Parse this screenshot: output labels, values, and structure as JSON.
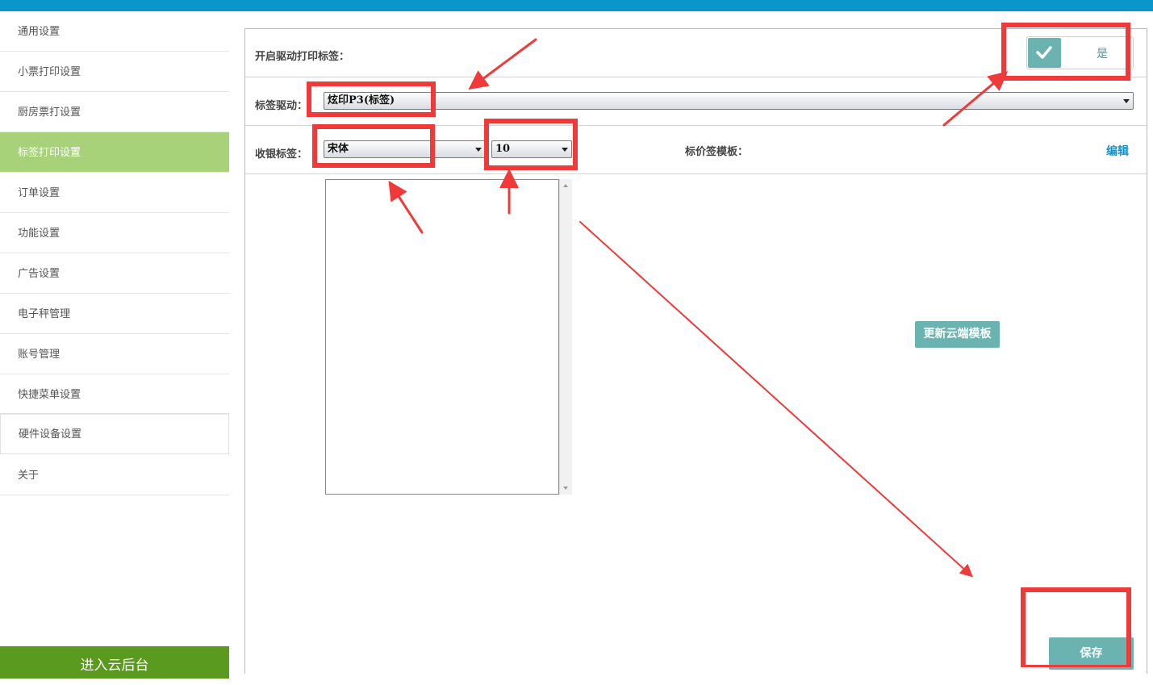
{
  "sidebar": {
    "items": [
      {
        "label": "通用设置"
      },
      {
        "label": "小票打印设置"
      },
      {
        "label": "厨房票打设置"
      },
      {
        "label": "标签打印设置"
      },
      {
        "label": "订单设置"
      },
      {
        "label": "功能设置"
      },
      {
        "label": "广告设置"
      },
      {
        "label": "电子秤管理"
      },
      {
        "label": "账号管理"
      },
      {
        "label": "快捷菜单设置"
      },
      {
        "label": "硬件设备设置"
      },
      {
        "label": "关于"
      }
    ],
    "enter_button": "进入云后台"
  },
  "form": {
    "enable_label": "开启驱动打印标签：",
    "enable_value": "是",
    "driver_label": "标签驱动：",
    "driver_value": "炫印P3(标签)",
    "cashier_label": "收银标签：",
    "font_value": "宋体",
    "size_value": "10",
    "template_label": "标价签模板：",
    "edit_link": "编辑",
    "cloud_button": "更新云端模板",
    "save_button": "保存"
  },
  "colors": {
    "topbar": "#0a96c8",
    "active_item": "#a7d27a",
    "enter_button": "#5a9a1e",
    "teal_button": "#6bb3b0",
    "annotation": "#f03a3a"
  }
}
